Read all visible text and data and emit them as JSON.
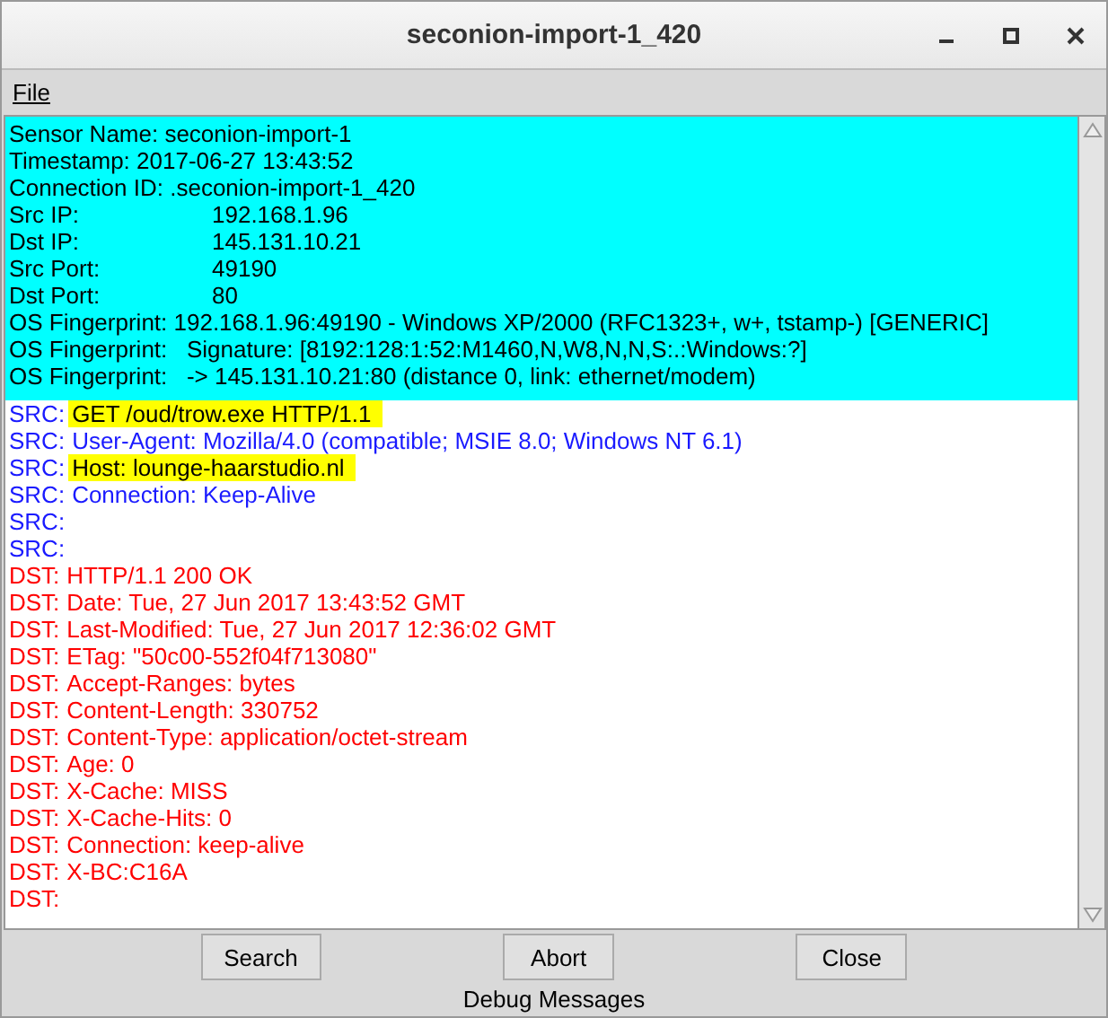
{
  "window": {
    "title": "seconion-import-1_420"
  },
  "menu": [
    {
      "label": "File"
    }
  ],
  "header": [
    {
      "kind": "text",
      "text": "Sensor Name: seconion-import-1"
    },
    {
      "kind": "text",
      "text": "Timestamp: 2017-06-27 13:43:52"
    },
    {
      "kind": "text",
      "text": "Connection ID: .seconion-import-1_420"
    },
    {
      "kind": "field",
      "label": "Src IP:",
      "value": "192.168.1.96"
    },
    {
      "kind": "field",
      "label": "Dst IP:",
      "value": "145.131.10.21"
    },
    {
      "kind": "field",
      "label": "Src Port:",
      "value": "49190"
    },
    {
      "kind": "field",
      "label": "Dst Port:",
      "value": "80"
    },
    {
      "kind": "text",
      "text": "OS Fingerprint: 192.168.1.96:49190 - Windows XP/2000 (RFC1323+, w+, tstamp-) [GENERIC]"
    },
    {
      "kind": "text",
      "text": "OS Fingerprint:   Signature: [8192:128:1:52:M1460,N,W8,N,N,S:.:Windows:?]"
    },
    {
      "kind": "text",
      "text": "OS Fingerprint:   -> 145.131.10.21:80 (distance 0, link: ethernet/modem)"
    }
  ],
  "lines": [
    {
      "kind": "src",
      "prefix": "SRC:",
      "text": "GET /oud/trow.exe HTTP/1.1",
      "highlighted": true
    },
    {
      "kind": "src",
      "prefix": "SRC:",
      "text": "User-Agent: Mozilla/4.0 (compatible; MSIE 8.0; Windows NT 6.1)",
      "highlighted": false
    },
    {
      "kind": "src",
      "prefix": "SRC:",
      "text": "Host: lounge-haarstudio.nl",
      "highlighted": true
    },
    {
      "kind": "src",
      "prefix": "SRC:",
      "text": "Connection: Keep-Alive",
      "highlighted": false
    },
    {
      "kind": "src",
      "prefix": "SRC:"
    },
    {
      "kind": "src",
      "prefix": "SRC:"
    },
    {
      "kind": "dst",
      "prefix": "DST:",
      "text": "HTTP/1.1 200 OK",
      "highlighted": false
    },
    {
      "kind": "dst",
      "prefix": "DST:",
      "text": "Date: Tue, 27 Jun 2017 13:43:52 GMT",
      "highlighted": false
    },
    {
      "kind": "dst",
      "prefix": "DST:",
      "text": "Last-Modified: Tue, 27 Jun 2017 12:36:02 GMT",
      "highlighted": false
    },
    {
      "kind": "dst",
      "prefix": "DST:",
      "text": "ETag: \"50c00-552f04f713080\"",
      "highlighted": false
    },
    {
      "kind": "dst",
      "prefix": "DST:",
      "text": "Accept-Ranges: bytes",
      "highlighted": false
    },
    {
      "kind": "dst",
      "prefix": "DST:",
      "text": "Content-Length: 330752",
      "highlighted": false
    },
    {
      "kind": "dst",
      "prefix": "DST:",
      "text": "Content-Type: application/octet-stream",
      "highlighted": false
    },
    {
      "kind": "dst",
      "prefix": "DST:",
      "text": "Age: 0",
      "highlighted": false
    },
    {
      "kind": "dst",
      "prefix": "DST:",
      "text": "X-Cache: MISS",
      "highlighted": false
    },
    {
      "kind": "dst",
      "prefix": "DST:",
      "text": "X-Cache-Hits: 0",
      "highlighted": false
    },
    {
      "kind": "dst",
      "prefix": "DST:",
      "text": "Connection: keep-alive",
      "highlighted": false
    },
    {
      "kind": "dst",
      "prefix": "DST:",
      "text": "X-BC:C16A",
      "highlighted": false
    },
    {
      "kind": "dst",
      "prefix": "DST:"
    }
  ],
  "buttons": [
    {
      "label": "Search"
    },
    {
      "label": "Abort"
    },
    {
      "label": "Close"
    }
  ],
  "status": "Debug Messages"
}
